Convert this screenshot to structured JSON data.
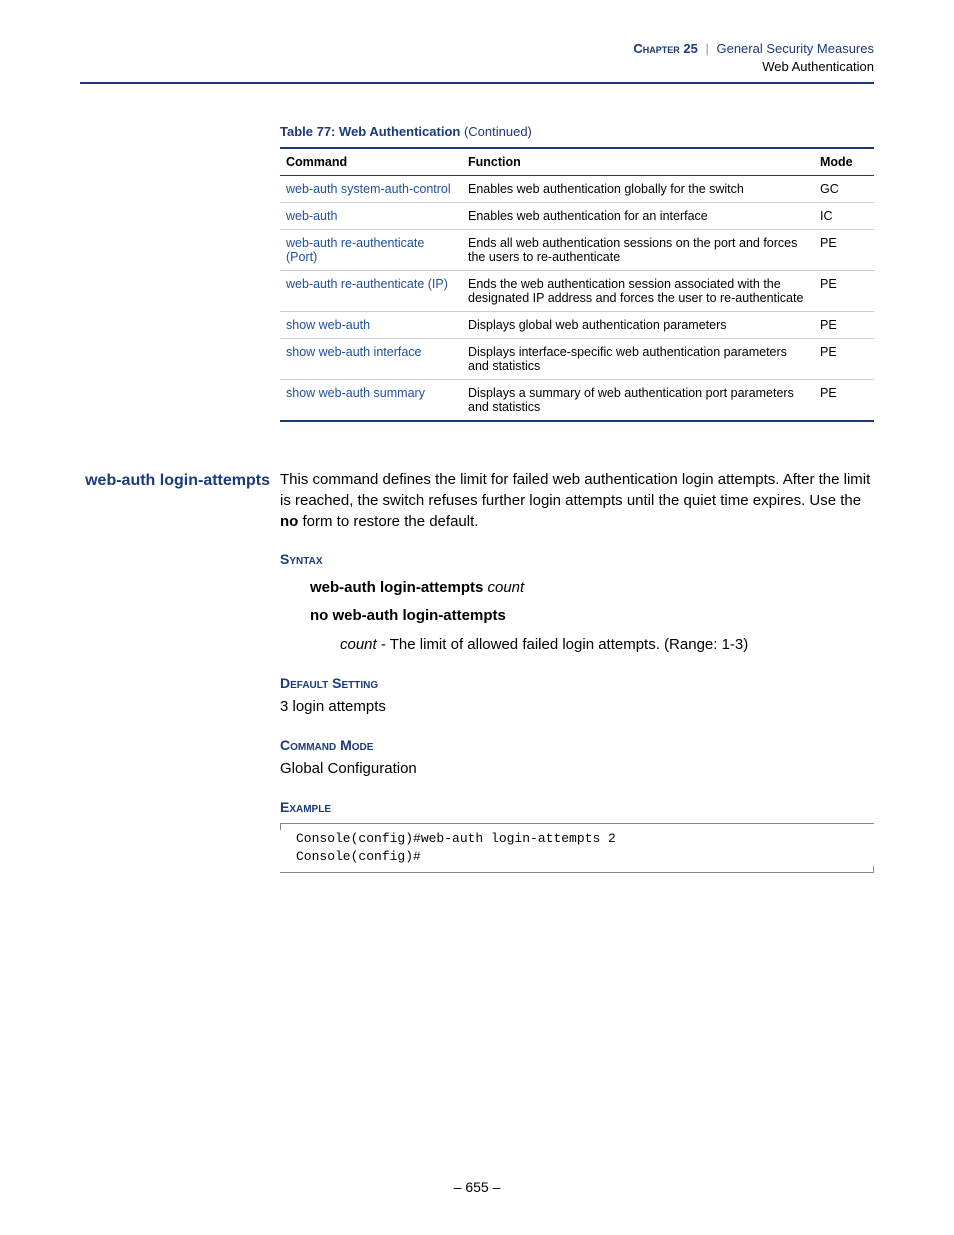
{
  "header": {
    "chapter_label": "Chapter 25",
    "separator": "|",
    "section_title": "General Security Measures",
    "subsection_title": "Web Authentication"
  },
  "table": {
    "caption_prefix": "Table 77: Web Authentication",
    "caption_suffix": " (Continued)",
    "headers": {
      "command": "Command",
      "function": "Function",
      "mode": "Mode"
    },
    "rows": [
      {
        "command": "web-auth system-auth-control",
        "function": "Enables web authentication globally for the switch",
        "mode": "GC"
      },
      {
        "command": "web-auth",
        "function": "Enables web authentication for an interface",
        "mode": "IC"
      },
      {
        "command": "web-auth re-authenticate (Port)",
        "function": "Ends all web authentication sessions on the port and forces the users to re-authenticate",
        "mode": "PE"
      },
      {
        "command": "web-auth re-authenticate (IP)",
        "function": "Ends the web authentication session associated with the designated IP address and forces the user to re-authenticate",
        "mode": "PE"
      },
      {
        "command": "show web-auth",
        "function": "Displays global web authentication parameters",
        "mode": "PE"
      },
      {
        "command": "show web-auth interface",
        "function": "Displays interface-specific web authentication parameters and statistics",
        "mode": "PE"
      },
      {
        "command": "show web-auth summary",
        "function": "Displays a summary of web authentication port parameters and statistics",
        "mode": "PE"
      }
    ]
  },
  "command_detail": {
    "name": "web-auth login-attempts",
    "description_pre": "This command defines the limit for failed web authentication login attempts. After the limit is reached, the switch refuses further login attempts until the quiet time expires. Use the ",
    "description_bold": "no",
    "description_post": " form to restore the default.",
    "syntax": {
      "label": "Syntax",
      "line1_bold": "web-auth login-attempts",
      "line1_ital": "count",
      "line2_bold": "no web-auth login-attempts",
      "param_name": "count",
      "param_desc": " - The limit of allowed failed login attempts. (Range: 1-3)"
    },
    "default": {
      "label": "Default Setting",
      "value": "3 login attempts"
    },
    "mode": {
      "label": "Command Mode",
      "value": "Global Configuration"
    },
    "example": {
      "label": "Example",
      "text": "Console(config)#web-auth login-attempts 2\nConsole(config)#"
    }
  },
  "footer": {
    "page_number": "– 655 –"
  }
}
